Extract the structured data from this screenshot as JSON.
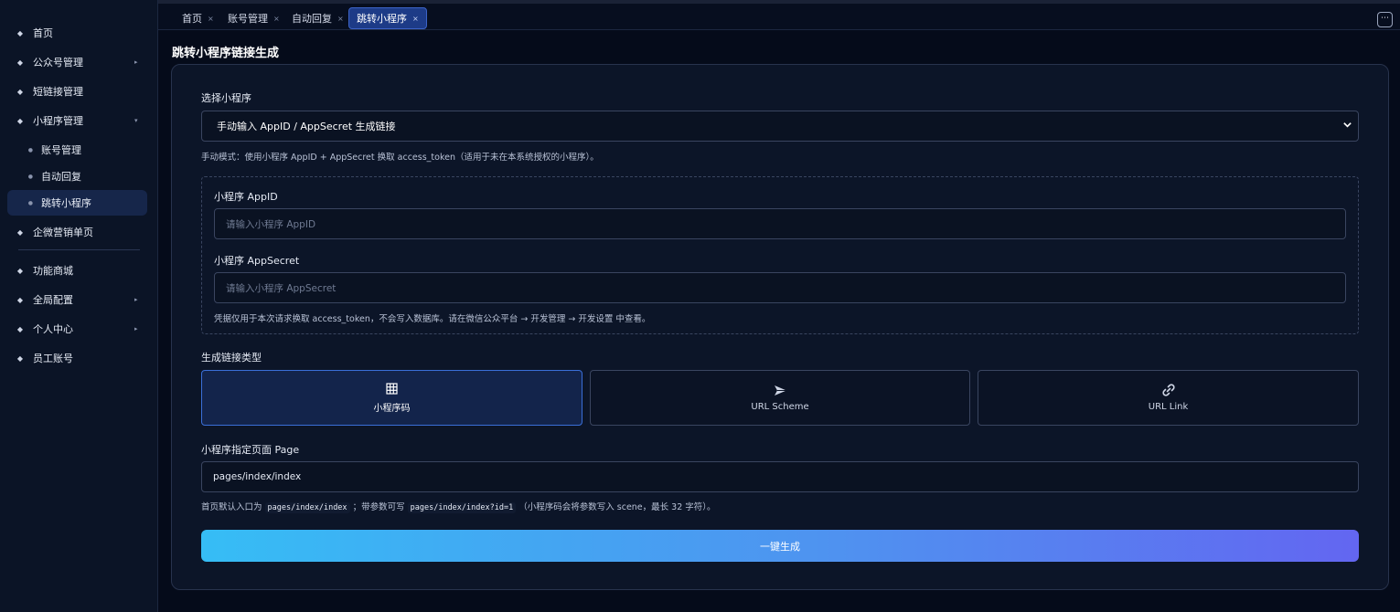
{
  "sidebar": {
    "items": [
      {
        "label": "首页",
        "has_arrow": false
      },
      {
        "label": "公众号管理",
        "has_arrow": true
      },
      {
        "label": "短链接管理",
        "has_arrow": false
      },
      {
        "label": "小程序管理",
        "has_arrow": true
      },
      {
        "label": "账号管理",
        "sub": true
      },
      {
        "label": "自动回复",
        "sub": true
      },
      {
        "label": "跳转小程序",
        "sub": true,
        "active": true
      },
      {
        "label": "企微营销单页",
        "has_arrow": false
      },
      {
        "label": "功能商城",
        "has_arrow": false
      },
      {
        "label": "全局配置",
        "has_arrow": true
      },
      {
        "label": "个人中心",
        "has_arrow": true
      },
      {
        "label": "员工账号",
        "has_arrow": false
      }
    ]
  },
  "tabs": [
    {
      "label": "首页",
      "close": "×"
    },
    {
      "label": "账号管理",
      "close": "×"
    },
    {
      "label": "自动回复",
      "close": "×"
    },
    {
      "label": "跳转小程序",
      "close": "×",
      "active": true
    }
  ],
  "more_label": "⋯",
  "page_title": "跳转小程序链接生成",
  "form": {
    "select_label": "选择小程序",
    "select_value": "手动输入 AppID / AppSecret 生成链接",
    "mode_hint": "手动模式：使用小程序 AppID + AppSecret 换取 access_token（适用于未在本系统授权的小程序）。",
    "appid_label": "小程序 AppID",
    "appid_placeholder": "请输入小程序 AppID",
    "secret_label": "小程序 AppSecret",
    "secret_placeholder": "请输入小程序 AppSecret",
    "credential_hint": "凭据仅用于本次请求换取 access_token，不会写入数据库。请在微信公众平台 → 开发管理 → 开发设置 中查看。",
    "type_label": "生成链接类型",
    "types": [
      {
        "label": "小程序码",
        "icon": "grid-icon",
        "active": true
      },
      {
        "label": "URL Scheme",
        "icon": "send-icon",
        "active": false
      },
      {
        "label": "URL Link",
        "icon": "link-icon",
        "active": false
      }
    ],
    "page_label": "小程序指定页面 Page",
    "page_value": "pages/index/index",
    "page_hint_1": "首页默认入口为",
    "page_hint_code_1": "pages/index/index",
    "page_hint_2": "；带参数可写",
    "page_hint_code_2": "pages/index/index?id=1",
    "page_hint_3": "（小程序码会将参数写入 scene，最长 32 字符）。",
    "submit_label": "一键生成"
  },
  "colors": {
    "accent": "#3a6fd8",
    "button_gradient_start": "#36bdf5",
    "button_gradient_end": "#6366f1",
    "background": "#050b1a"
  }
}
